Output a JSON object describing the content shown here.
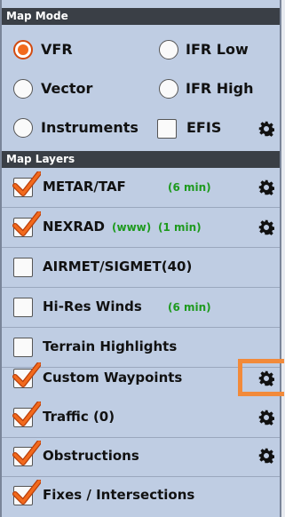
{
  "map_mode": {
    "header": "Map Mode",
    "options": {
      "vfr": "VFR",
      "ifr_low": "IFR Low",
      "vector": "Vector",
      "ifr_high": "IFR High",
      "instruments": "Instruments",
      "efis": "EFIS"
    },
    "selected": "VFR"
  },
  "map_layers": {
    "header": "Map Layers",
    "items": [
      {
        "label": "METAR/TAF",
        "checked": true,
        "age": "(6 min)",
        "has_settings": true
      },
      {
        "label": "NEXRAD",
        "checked": true,
        "source": "(www)",
        "age": "(1 min)",
        "has_settings": true
      },
      {
        "label": "AIRMET/SIGMET(40)",
        "checked": false,
        "has_settings": false
      },
      {
        "label": "Hi-Res Winds",
        "checked": false,
        "age": "(6 min)",
        "has_settings": false
      },
      {
        "label": "Terrain Highlights",
        "checked": false,
        "has_settings": false
      },
      {
        "label": "Custom Waypoints",
        "checked": true,
        "has_settings": true,
        "highlighted": true
      },
      {
        "label": "Traffic (0)",
        "checked": true,
        "has_settings": true
      },
      {
        "label": "Obstructions",
        "checked": true,
        "has_settings": true
      },
      {
        "label": "Fixes / Intersections",
        "checked": true,
        "has_settings": false
      }
    ]
  },
  "colors": {
    "panel_bg": "#bfcde3",
    "header_bg": "#3a3f46",
    "accent_orange": "#f26a1d",
    "age_green": "#1e9a1e",
    "highlight_orange": "#f28a3a"
  }
}
